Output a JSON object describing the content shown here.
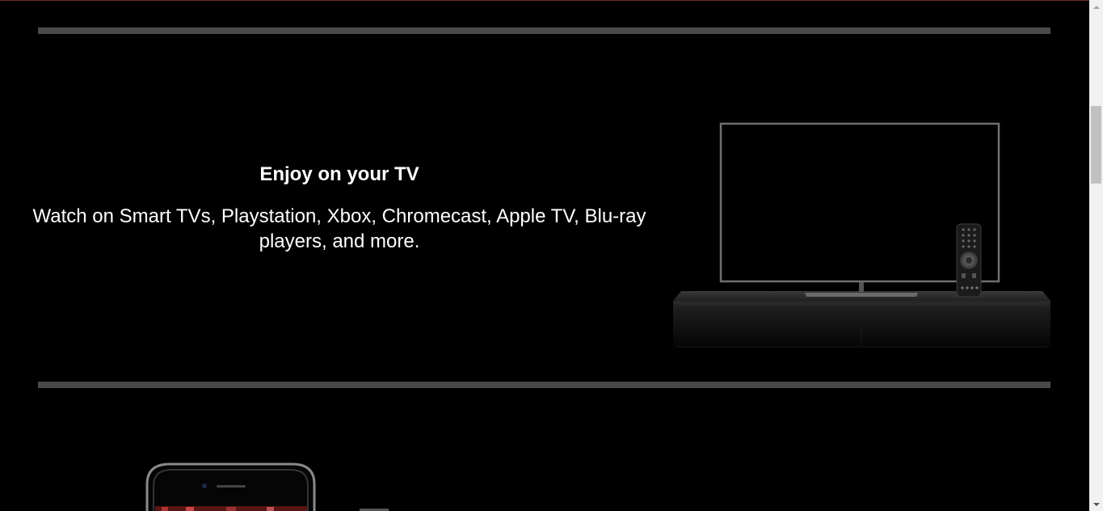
{
  "tv_section": {
    "title": "Enjoy on your TV",
    "description": "Watch on Smart TVs, Playstation, Xbox, Chromecast, Apple TV, Blu-ray players, and more."
  },
  "colors": {
    "background": "#000000",
    "divider": "#4a4a4a",
    "text": "#ffffff"
  },
  "icons": {
    "tv": "tv-icon",
    "remote": "remote-icon",
    "phone": "phone-icon"
  }
}
